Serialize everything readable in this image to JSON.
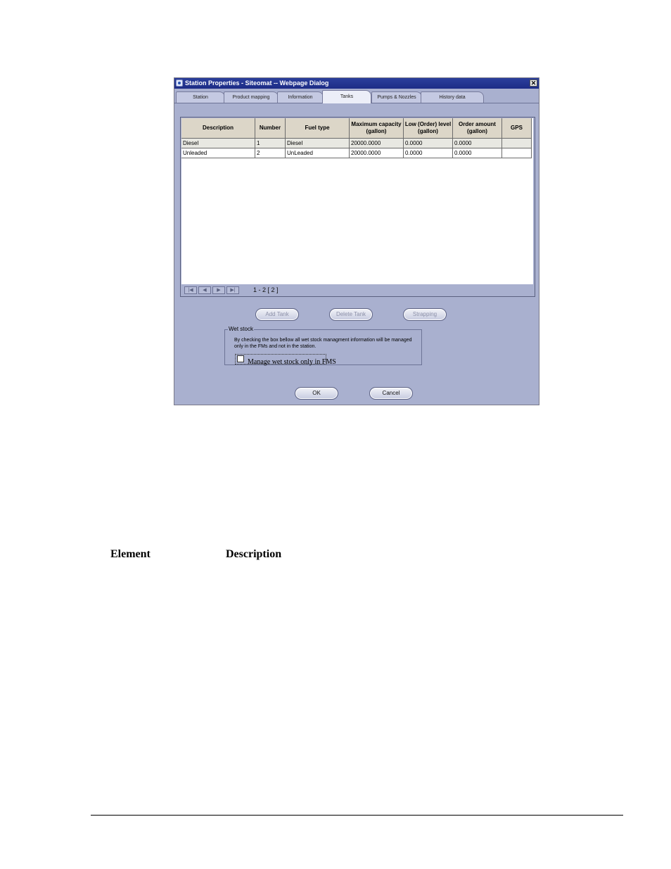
{
  "dialog": {
    "title": "Station Properties - Siteomat -- Webpage Dialog",
    "close_label": "✕",
    "tabs": [
      {
        "label": "Station"
      },
      {
        "label": "Product mapping"
      },
      {
        "label": "Information"
      },
      {
        "label": "Tanks",
        "active": true
      },
      {
        "label": "Pumps & Nozzles"
      },
      {
        "label": "History data"
      }
    ],
    "grid": {
      "columns": [
        "Description",
        "Number",
        "Fuel type",
        "Maximum capacity (gallon)",
        "Low (Order) level (gallon)",
        "Order amount (gallon)",
        "GPS"
      ],
      "rows": [
        [
          "Diesel",
          "1",
          "Diesel",
          "20000.0000",
          "0.0000",
          "0.0000",
          ""
        ],
        [
          "Unleaded",
          "2",
          "UnLeaded",
          "20000.0000",
          "0.0000",
          "0.0000",
          ""
        ]
      ]
    },
    "pager": {
      "first_icon": "first-page-icon",
      "prev_icon": "prev-page-icon",
      "next_icon": "next-page-icon",
      "last_icon": "last-page-icon",
      "text": "1 - 2  [ 2 ]"
    },
    "actions": {
      "add_tank": "Add Tank",
      "delete_tank": "Delete Tank",
      "strapping": "Strapping"
    },
    "wet_stock": {
      "legend": "Wet stock",
      "description": "By checking the box bellow all wet stock managment information will be managed only in the FMs and not in the station.",
      "checkbox_label": "Manage wet stock only in FMS",
      "checked": false
    },
    "footer": {
      "ok": "OK",
      "cancel": "Cancel"
    }
  },
  "document": {
    "col_element": "Element",
    "col_description": "Description"
  }
}
